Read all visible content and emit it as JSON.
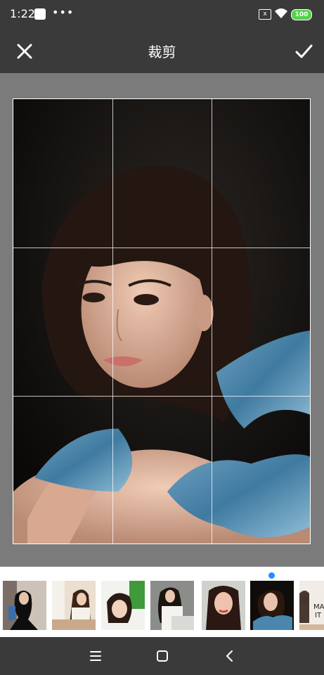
{
  "status": {
    "time": "1:22",
    "dots": "•••",
    "sim_label": "x",
    "battery": "100"
  },
  "toolbar": {
    "title": "裁剪",
    "close_icon": "close-icon",
    "confirm_icon": "check-icon"
  },
  "crop": {
    "grid": "3x3"
  },
  "thumbnails": {
    "count": 7,
    "selected_index": 5,
    "partial_text": "MA\nIT"
  },
  "navbar": {
    "menu_icon": "menu-icon",
    "home_icon": "home-icon",
    "back_icon": "back-icon"
  }
}
